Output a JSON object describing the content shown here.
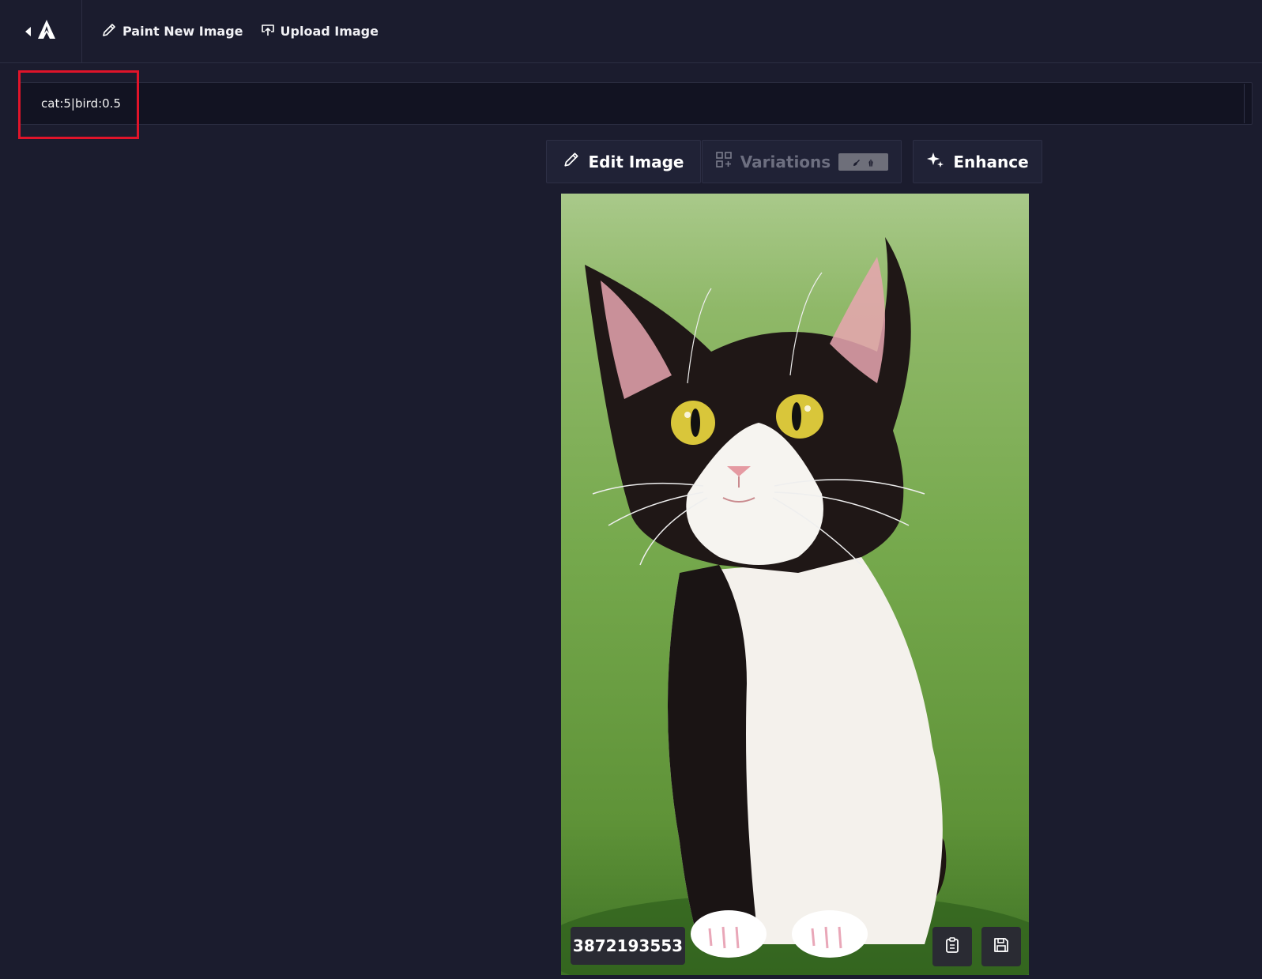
{
  "topbar": {
    "back_icon": "caret-left-icon",
    "logo_icon": "logo-icon",
    "paint_new_label": "Paint New Image",
    "paint_new_icon": "pencil-icon",
    "upload_label": "Upload Image",
    "upload_icon": "upload-icon"
  },
  "prompt": {
    "value": "cat:5|bird:0.5",
    "placeholder": ""
  },
  "actions": {
    "edit_label": "Edit Image",
    "edit_icon": "pencil-icon",
    "variations_label": "Variations",
    "variations_icon": "grid-plus-icon",
    "variations_badge_icons": [
      "brush-icon",
      "leaf-icon"
    ],
    "enhance_label": "Enhance",
    "enhance_icon": "sparkle-icon"
  },
  "result": {
    "image_subject": "black and white cat sitting on grass",
    "seed": "3872193553",
    "copy_icon": "clipboard-icon",
    "save_icon": "save-icon"
  },
  "colors": {
    "background": "#1b1c2e",
    "highlight": "#e0142a",
    "button_bg": "#202236"
  }
}
